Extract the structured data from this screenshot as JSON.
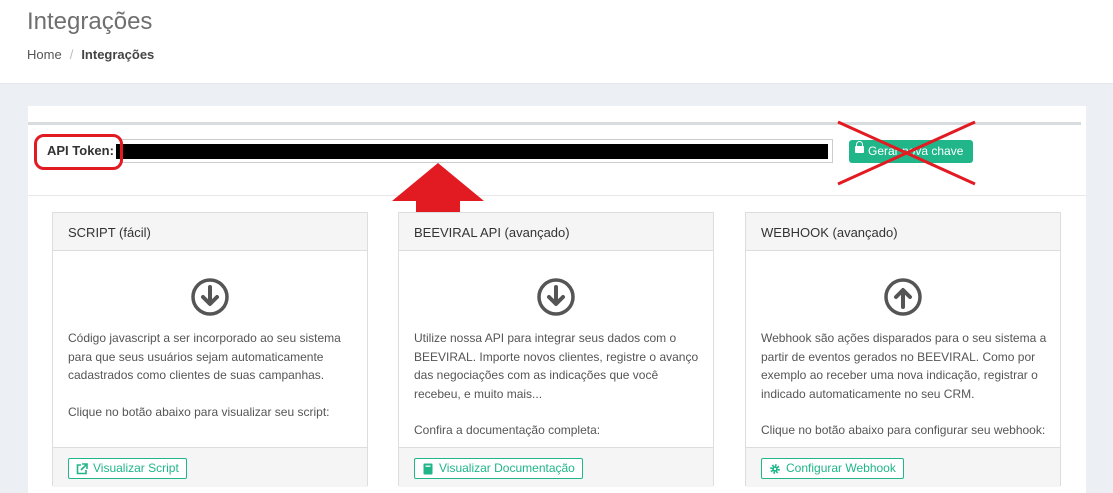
{
  "header": {
    "title": "Integrações",
    "breadcrumb": {
      "home": "Home",
      "separator": "/",
      "current": "Integrações"
    }
  },
  "token": {
    "label": "API Token:",
    "value": "",
    "generate_button": "Gerar nova chave"
  },
  "cards": [
    {
      "title": "SCRIPT (fácil)",
      "icon": "arrow-circle-down-icon",
      "paragraph1": "Código javascript a ser incorporado ao seu sistema para que seus usuários sejam automaticamente cadastrados como clientes de suas campanhas.",
      "paragraph2": "Clique no botão abaixo para visualizar seu script:",
      "button": "Visualizar Script",
      "button_icon": "external-link-icon"
    },
    {
      "title": "BEEVIRAL API (avançado)",
      "icon": "arrow-circle-down-icon",
      "paragraph1": "Utilize nossa API para integrar seus dados com o BEEVIRAL. Importe novos clientes, registre o avanço das negociações com as indicações que você recebeu, e muito mais...",
      "paragraph2": "Confira a documentação completa:",
      "button": "Visualizar Documentação",
      "button_icon": "book-icon"
    },
    {
      "title": "WEBHOOK (avançado)",
      "icon": "arrow-circle-up-icon",
      "paragraph1": "Webhook são ações disparados para o seu sistema a partir de eventos gerados no BEEVIRAL. Como por exemplo ao receber uma nova indicação, registrar o indicado automaticamente no seu CRM.",
      "paragraph2": "Clique no botão abaixo para configurar seu webhook:",
      "button": "Configurar Webhook",
      "button_icon": "gear-icon"
    }
  ],
  "colors": {
    "accent": "#20b68a",
    "annotation": "#e21b23"
  }
}
